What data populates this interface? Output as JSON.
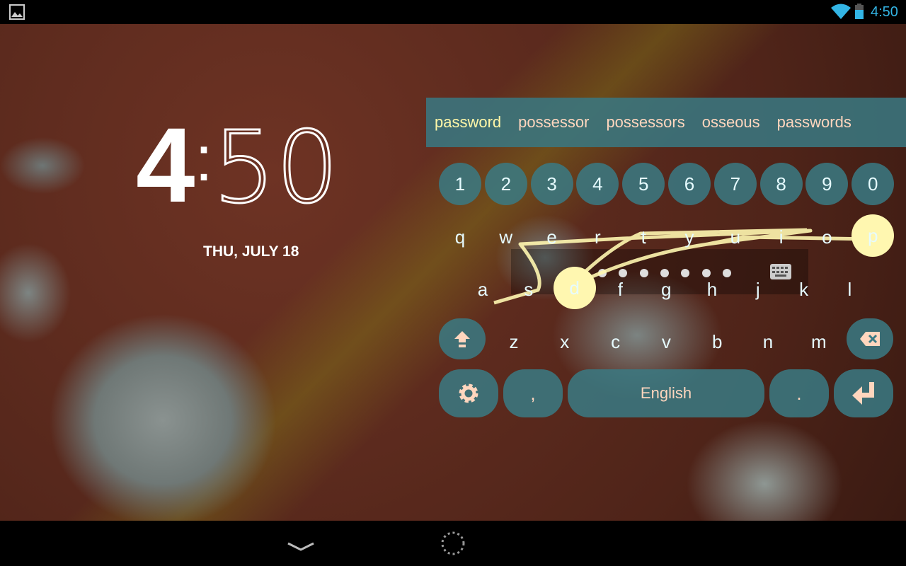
{
  "status_bar": {
    "time": "4:50",
    "icons": [
      "image-icon",
      "wifi-icon",
      "battery-icon"
    ],
    "accent": "#33b5e5"
  },
  "lockscreen": {
    "hour": "4",
    "colon": ":",
    "minutes": "50",
    "date": "THU, JULY 18"
  },
  "keyboard": {
    "suggestions": [
      "password",
      "possessor",
      "possessors",
      "osseous",
      "passwords"
    ],
    "numbers": [
      "1",
      "2",
      "3",
      "4",
      "5",
      "6",
      "7",
      "8",
      "9",
      "0"
    ],
    "row1": [
      "q",
      "w",
      "e",
      "r",
      "t",
      "y",
      "u",
      "i",
      "o",
      "p"
    ],
    "row2": [
      "a",
      "s",
      "d",
      "f",
      "g",
      "h",
      "j",
      "k",
      "l"
    ],
    "row3": [
      "z",
      "x",
      "c",
      "v",
      "b",
      "n",
      "m"
    ],
    "comma": ",",
    "space": "English",
    "period": ".",
    "highlighted_keys": [
      "d",
      "p"
    ],
    "key_color": "#3a7a84",
    "label_color": "#ffd6be",
    "trail_color": "#fff7b0"
  },
  "nav_bar": {
    "icons": [
      "chevron-down-icon",
      "loading-spinner-icon"
    ]
  }
}
